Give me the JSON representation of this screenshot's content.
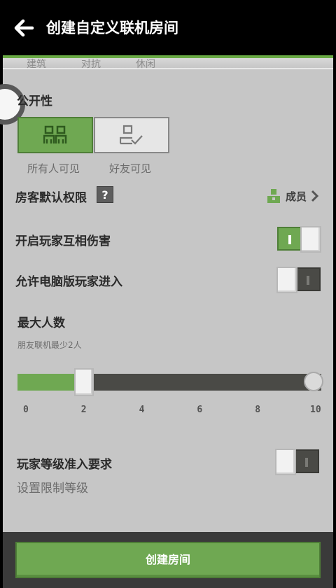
{
  "header": {
    "title": "创建自定义联机房间"
  },
  "mode_tabs_cut": [
    "建筑",
    "对抗",
    "休闲"
  ],
  "visibility": {
    "label": "公开性",
    "options": [
      {
        "label": "所有人可见",
        "icon": "group-icon",
        "selected": true
      },
      {
        "label": "好友可见",
        "icon": "friend-check-icon",
        "selected": false
      }
    ]
  },
  "guest_permission": {
    "label": "房客默认权限",
    "help": "?",
    "value": "成员",
    "icon": "member-icon"
  },
  "settings": {
    "pvp": {
      "label": "开启玩家互相伤害",
      "on": true
    },
    "pc_join": {
      "label": "允许电脑版玩家进入",
      "on": false
    }
  },
  "max_players": {
    "label": "最大人数",
    "hint": "朋友联机最少2人",
    "ticks": [
      "0",
      "2",
      "4",
      "6",
      "8",
      "10"
    ],
    "min": 0,
    "max": 10,
    "value": 2
  },
  "level_requirement": {
    "label": "玩家等级准入要求",
    "sub": "设置限制等级",
    "on": false
  },
  "create_button": {
    "label": "创建房间"
  },
  "colors": {
    "accent": "#6fa852",
    "panel": "#c6c6c6",
    "dark_track": "#4a4a46"
  }
}
